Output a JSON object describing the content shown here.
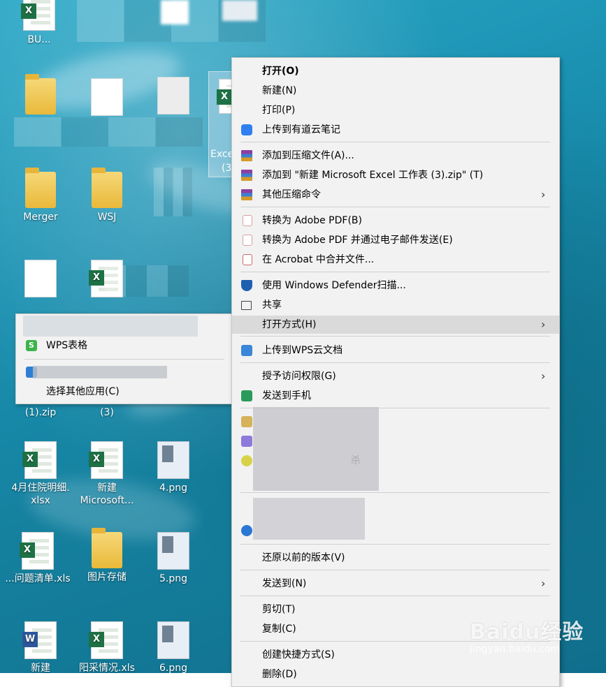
{
  "desktop": {
    "icons": [
      {
        "label": "BU...",
        "type": "xlsx"
      },
      {
        "label": "Merger",
        "type": "folder"
      },
      {
        "label": "WSJ",
        "type": "folder"
      },
      {
        "label": "(1).zip",
        "type": "zip"
      },
      {
        "label": "(3)",
        "type": "xlsx"
      },
      {
        "label": "4月住院明细.\nxlsx",
        "type": "xlsx"
      },
      {
        "label": "新建\nMicrosoft...",
        "type": "xlsx"
      },
      {
        "label": "4.png",
        "type": "png"
      },
      {
        "label": "...问题清单.xls",
        "type": "xlsx"
      },
      {
        "label": "图片存储",
        "type": "folder"
      },
      {
        "label": "5.png",
        "type": "png"
      },
      {
        "label": "新建",
        "type": "word"
      },
      {
        "label": "阳采情况.xls",
        "type": "xlsx"
      },
      {
        "label": "6.png",
        "type": "png"
      },
      {
        "label": "Exce",
        "type": "xlsx-selected"
      },
      {
        "label": "(3",
        "type": "xlsx-selected"
      }
    ]
  },
  "context_menu": {
    "items": [
      {
        "label": "打开(O)",
        "bold": true
      },
      {
        "label": "新建(N)"
      },
      {
        "label": "打印(P)"
      },
      {
        "label": "上传到有道云笔记",
        "icon": "youdao-note-icon"
      },
      {
        "label": "添加到压缩文件(A)...",
        "icon": "winrar-icon"
      },
      {
        "label": "添加到 \"新建 Microsoft Excel 工作表 (3).zip\" (T)",
        "icon": "winrar-icon"
      },
      {
        "label": "其他压缩命令",
        "icon": "winrar-icon",
        "submenu": true
      },
      {
        "label": "转换为 Adobe PDF(B)",
        "icon": "adobe-pdf-icon"
      },
      {
        "label": "转换为 Adobe PDF 并通过电子邮件发送(E)",
        "icon": "adobe-pdf-email-icon"
      },
      {
        "label": "在 Acrobat 中合并文件...",
        "icon": "acrobat-combine-icon"
      },
      {
        "label": "使用 Windows Defender扫描...",
        "icon": "windows-defender-icon"
      },
      {
        "label": "共享",
        "icon": "share-icon"
      },
      {
        "label": "打开方式(H)",
        "submenu": true,
        "highlighted": true
      },
      {
        "label": "上传到WPS云文档",
        "icon": "wps-cloud-icon"
      },
      {
        "label": "授予访问权限(G)",
        "submenu": true
      },
      {
        "label": "发送到手机",
        "icon": "send-to-phone-icon"
      },
      {
        "label": "还原以前的版本(V)"
      },
      {
        "label": "发送到(N)",
        "submenu": true
      },
      {
        "label": "剪切(T)"
      },
      {
        "label": "复制(C)"
      },
      {
        "label": "创建快捷方式(S)"
      },
      {
        "label": "删除(D)"
      }
    ],
    "partial_text": "杀"
  },
  "open_with_menu": {
    "items": [
      {
        "label": "WPS表格",
        "icon": "wps-spreadsheet-icon"
      },
      {
        "label": "选择其他应用(C)"
      }
    ]
  },
  "watermark": {
    "brand": "Baidu经验",
    "site": "jingyan.baidu.com"
  },
  "colors": {
    "menu_bg": "#f2f2f2",
    "highlight": "#dadada",
    "desktop": "#1a8fb0",
    "excel_green": "#1e7145",
    "wps_green": "#3cb34a"
  }
}
